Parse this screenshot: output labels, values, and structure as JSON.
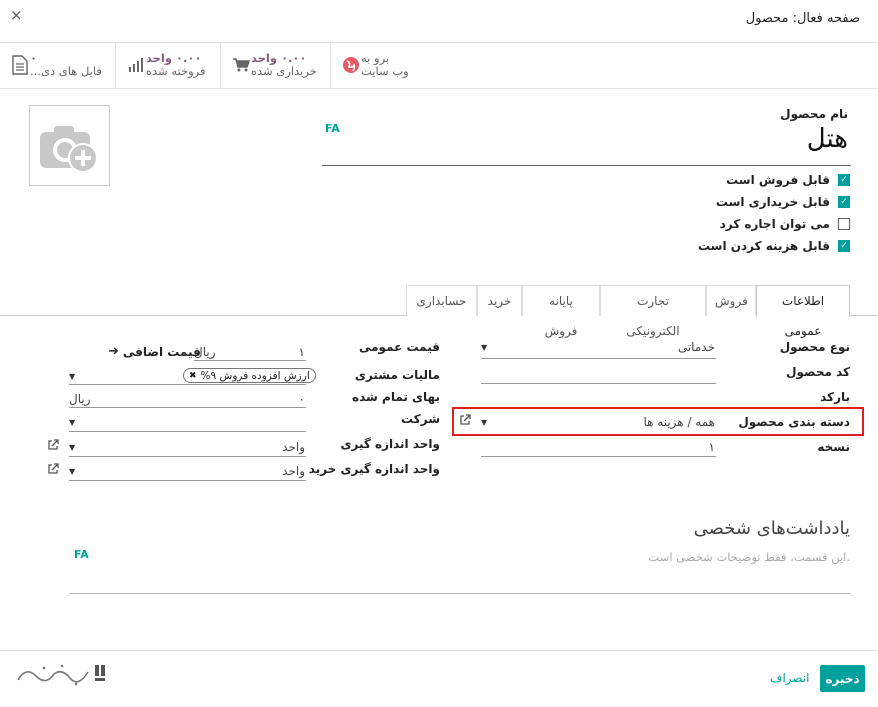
{
  "header": {
    "title": "صفحه فعال: محصول",
    "close": "×"
  },
  "smart_buttons": {
    "website": {
      "line1": "برو به",
      "line2": "وب سایت"
    },
    "purchased": {
      "value": "۰.۰۰ واحد",
      "label": "خریداری شده"
    },
    "sold": {
      "value": "۰.۰۰ واحد",
      "label": "فروخته شده"
    },
    "documents": {
      "value": "۰",
      "label": "فایل های دی..."
    }
  },
  "product": {
    "name_label": "نام محصول",
    "name": "هتل",
    "lang_badge": "FA",
    "checkboxes": [
      {
        "label": "قابل فروش است",
        "checked": true
      },
      {
        "label": "قابل خریداری است",
        "checked": true
      },
      {
        "label": "می توان اجاره کرد",
        "checked": false
      },
      {
        "label": "قابل هزینه کردن است",
        "checked": true
      }
    ]
  },
  "tabs": [
    "اطلاعات عمومی",
    "فروش",
    "تجارت الکترونیکی",
    "پایانه فروش",
    "خرید",
    "حسابداری"
  ],
  "general": {
    "right": {
      "product_type": {
        "label": "نوع محصول",
        "value": "خدماتی"
      },
      "internal_ref": {
        "label": "کد محصول",
        "value": ""
      },
      "barcode": {
        "label": "بارکد",
        "value": ""
      },
      "category": {
        "label": "دسته بندی محصول",
        "value": "همه / هزینه ها"
      },
      "version": {
        "label": "نسخه",
        "value": "۱"
      }
    },
    "left": {
      "sales_price": {
        "label": "قیمت عمومی",
        "value": "۱",
        "currency": "ریال",
        "extra": "قیمت اضافی"
      },
      "customer_taxes": {
        "label": "مالیات مشتری",
        "tag": "ارزش افزوده فروش ۹%"
      },
      "cost": {
        "label": "بهای تمام شده",
        "value": "۰",
        "currency": "ریال"
      },
      "company": {
        "label": "شرکت",
        "value": ""
      },
      "uom": {
        "label": "واحد اندازه گیری",
        "value": "واحد"
      },
      "purchase_uom": {
        "label": "واحد اندازه گیری خرید",
        "value": "واحد"
      }
    }
  },
  "notes": {
    "title": "یادداشت‌های شخصی",
    "placeholder": "این قسمت، فقط توضیحات شخصی است.",
    "lang_badge": "FA"
  },
  "footer": {
    "save": "ذخیره",
    "discard": "انصراف"
  },
  "colors": {
    "accent": "#00a09d",
    "highlight": "#e02020",
    "smart_value": "#875a7b"
  },
  "icons": [
    "globe-icon",
    "cart-icon",
    "bar-chart-icon",
    "document-icon",
    "camera-plus-icon",
    "external-link-icon",
    "arrow-icon"
  ]
}
